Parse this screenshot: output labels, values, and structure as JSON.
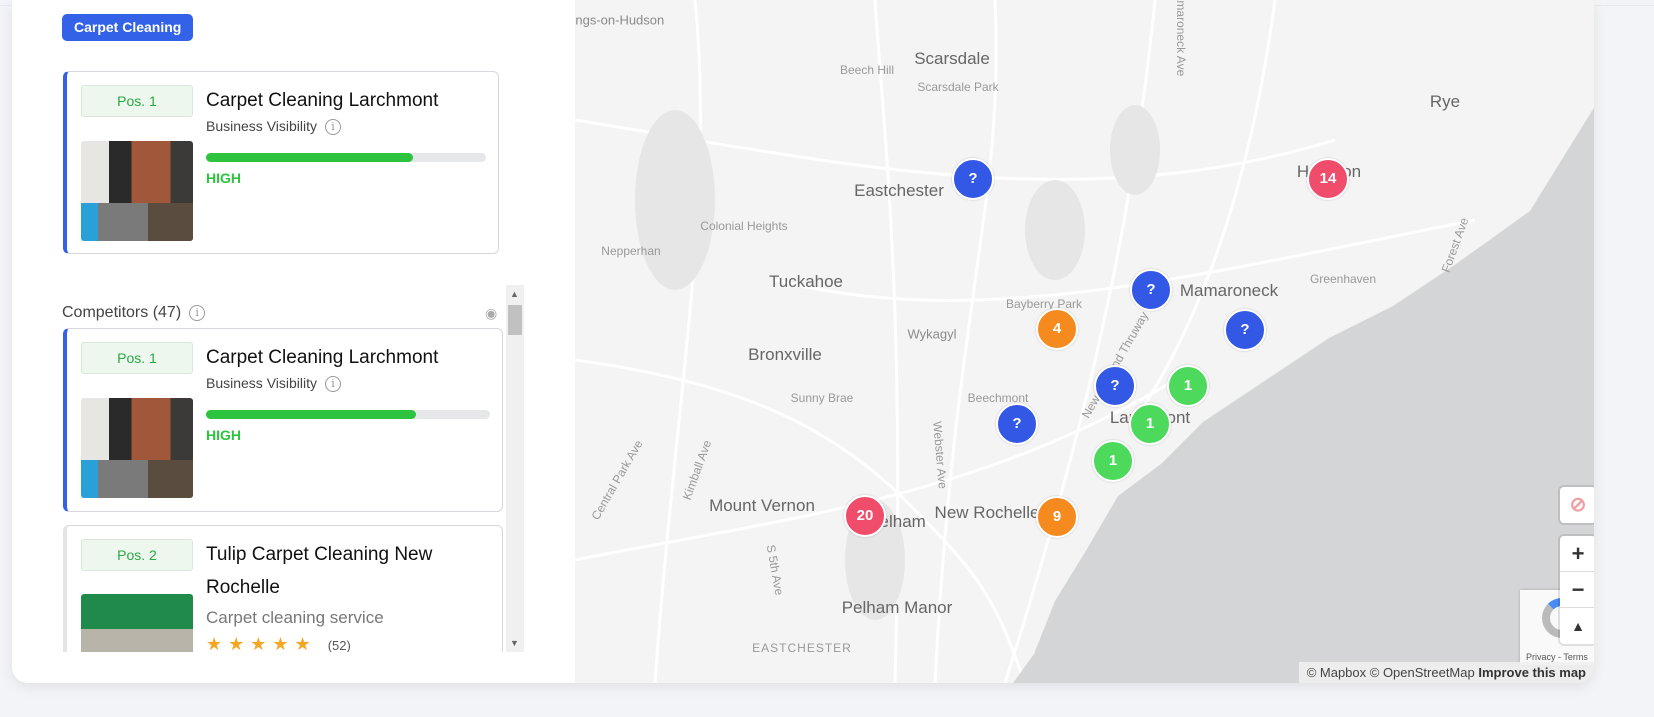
{
  "keyword_badge": "Carpet Cleaning",
  "my_business": {
    "position": "Pos. 1",
    "name": "Carpet Cleaning Larchmont",
    "visibility_label": "Business Visibility",
    "visibility_percent": 74,
    "visibility_level": "HIGH"
  },
  "competitors": {
    "title": "Competitors (47)",
    "items": [
      {
        "position": "Pos. 1",
        "name": "Carpet Cleaning Larchmont",
        "visibility_label": "Business Visibility",
        "visibility_percent": 74,
        "visibility_level": "HIGH"
      },
      {
        "position": "Pos. 2",
        "name": "Tulip Carpet Cleaning New Rochelle",
        "category": "Carpet cleaning service",
        "stars": "★★★★★",
        "rating_count": "(52)"
      }
    ]
  },
  "map": {
    "labels": [
      "Hastings-on-Hudson",
      "Scarsdale",
      "Beech Hill",
      "Scarsdale Park",
      "Rye",
      "Harrison",
      "Eastchester",
      "Colonial Heights",
      "Nepperhan",
      "Tuckahoe",
      "Mamaroneck",
      "Greenhaven",
      "Bayberry Park",
      "Wykagyl",
      "Bronxville",
      "Sunny Brae",
      "Beechmont",
      "Larchmont",
      "Mount Vernon",
      "Pelham",
      "New Rochelle",
      "Pelham Manor",
      "EASTCHESTER",
      "Central Park Ave",
      "Kimball Ave",
      "Webster Ave",
      "S 5th Ave",
      "New England Thruway",
      "Forest Ave",
      "Mamaroneck Ave"
    ],
    "markers": [
      {
        "label": "?",
        "color": "#3358e6"
      },
      {
        "label": "14",
        "color": "#ef4d6b"
      },
      {
        "label": "?",
        "color": "#3358e6"
      },
      {
        "label": "?",
        "color": "#3358e6"
      },
      {
        "label": "4",
        "color": "#f58a1f"
      },
      {
        "label": "?",
        "color": "#3358e6"
      },
      {
        "label": "1",
        "color": "#4cd95c"
      },
      {
        "label": "1",
        "color": "#4cd95c"
      },
      {
        "label": "?",
        "color": "#3358e6"
      },
      {
        "label": "1",
        "color": "#4cd95c"
      },
      {
        "label": "20",
        "color": "#ef4d6b"
      },
      {
        "label": "9",
        "color": "#f58a1f"
      }
    ],
    "controls": {
      "zoom_in": "+",
      "zoom_out": "−",
      "compass": "▲"
    },
    "recaptcha": "Privacy - Terms",
    "attribution": "© Mapbox © OpenStreetMap",
    "improve": "Improve this map"
  }
}
